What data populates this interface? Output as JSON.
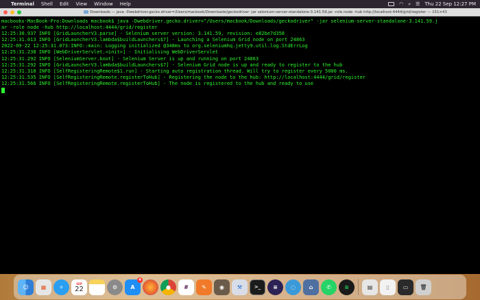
{
  "menubar": {
    "apple": "",
    "app": "Terminal",
    "items": [
      "Shell",
      "Edit",
      "View",
      "Window",
      "Help"
    ],
    "datetime": "Thu 22 Sep  12:27 PM"
  },
  "window": {
    "title": "Downloads — java -Dwebdriver.gecko.driver=/Users/macbook/Downloads/geckodriver -jar selenium-server-standalone-3.141.59.jar -role node -hub http://localhost:4444/grid/register — 151×43"
  },
  "console": {
    "lines": [
      "macbooks-MacBook-Pro:Downloads macbook$ java -Dwebdriver.gecko.driver=\"/Users/macbook/Downloads/geckodriver\" -jar selenium-server-standalone-3.141.59.j",
      "ar -role node -hub http://localhost:4444/grid/register",
      "12:25:30.937 INFO [GridLauncherV3.parse] - Selenium server version: 3.141.59, revision: e82be7d358",
      "12:25:31.013 INFO [GridLauncherV3.lambda$buildLaunchers$7] - Launching a Selenium Grid node on port 24863",
      "2022-09-22 12:25:31.073:INFO::main: Logging initialized @348ms to org.seleniumhq.jetty9.util.log.StdErrLog",
      "12:25:31.238 INFO [WebDriverServlet.<init>] - Initialising WebDriverServlet",
      "12:25:31.292 INFO [SeleniumServer.boot] - Selenium Server is up and running on port 24863",
      "12:25:31.292 INFO [GridLauncherV3.lambda$buildLaunchers$7] - Selenium Grid node is up and ready to register to the hub",
      "12:25:31.318 INFO [SelfRegisteringRemote$1.run] - Starting auto registration thread. Will try to register every 5000 ms.",
      "12:25:31.535 INFO [SelfRegisteringRemote.registerToHub] - Registering the node to the hub: http://localhost:4444/grid/register",
      "12:25:31.566 INFO [SelfRegisteringRemote.registerToHub] - The node is registered to the hub and ready to use"
    ]
  },
  "dock": {
    "calendar_month": "SEP",
    "calendar_day": "22",
    "badge": "4",
    "icons": [
      {
        "name": "finder-icon",
        "color": "#3d8ee8"
      },
      {
        "name": "launchpad-icon",
        "color": "#e0e0e0"
      },
      {
        "name": "safari-icon",
        "color": "#2a9ef0"
      },
      {
        "name": "calendar-icon",
        "color": "#ffffff"
      },
      {
        "name": "notes-icon",
        "color": "#f7d35a"
      },
      {
        "name": "system-preferences-icon",
        "color": "#8a8a8a"
      },
      {
        "name": "app-store-icon",
        "color": "#1f8ff5"
      },
      {
        "name": "firefox-icon",
        "color": "#e8632e"
      },
      {
        "name": "chrome-icon",
        "color": "#e6e6e6"
      },
      {
        "name": "slack-icon",
        "color": "#ffffff"
      },
      {
        "name": "pencil-app-icon",
        "color": "#f07a2a"
      },
      {
        "name": "preview-icon",
        "color": "#6b5b4a"
      },
      {
        "name": "xcode-icon",
        "color": "#d8dde8"
      },
      {
        "name": "terminal-icon",
        "color": "#1b1b1b"
      },
      {
        "name": "eclipse-icon",
        "color": "#2c2255"
      },
      {
        "name": "screen-recorder-icon",
        "color": "#3a9ad9"
      },
      {
        "name": "notch-app-icon",
        "color": "#4f6fa0"
      },
      {
        "name": "whatsapp-icon",
        "color": "#25d366"
      },
      {
        "name": "spotify-icon",
        "color": "#1a1a1a"
      },
      {
        "name": "downloads-stack-icon",
        "color": "#e6e6e6"
      },
      {
        "name": "document-icon",
        "color": "#f2f2f2"
      },
      {
        "name": "folder-stack-icon",
        "color": "#2a2a2a"
      },
      {
        "name": "trash-icon",
        "color": "#d0d0d0"
      }
    ]
  }
}
